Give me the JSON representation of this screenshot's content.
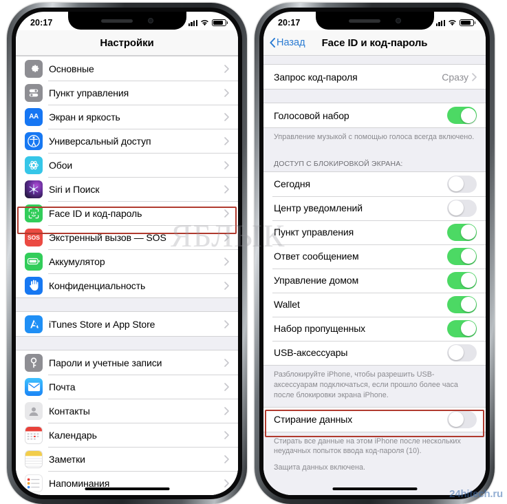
{
  "watermarks": {
    "center": "ЯБЛЫК",
    "corner": "24hitech.ru"
  },
  "status_bar": {
    "time": "20:17",
    "signal_icon": "cellular-bars-icon",
    "wifi_icon": "wifi-icon",
    "battery_icon": "battery-icon"
  },
  "left_phone": {
    "nav": {
      "title": "Настройки"
    },
    "groups": [
      {
        "rows": [
          {
            "label": "Основные",
            "icon": "gear-icon",
            "accessory": "chevron"
          },
          {
            "label": "Пункт управления",
            "icon": "control-center-icon",
            "accessory": "chevron"
          },
          {
            "label": "Экран и яркость",
            "icon": "display-icon",
            "accessory": "chevron"
          },
          {
            "label": "Универсальный доступ",
            "icon": "accessibility-icon",
            "accessory": "chevron"
          },
          {
            "label": "Обои",
            "icon": "wallpaper-icon",
            "accessory": "chevron"
          },
          {
            "label": "Siri и Поиск",
            "icon": "siri-icon",
            "accessory": "chevron"
          },
          {
            "label": "Face ID и код-пароль",
            "icon": "faceid-icon",
            "accessory": "chevron",
            "highlighted": true
          },
          {
            "label": "Экстренный вызов — SOS",
            "icon": "sos-icon",
            "accessory": "chevron"
          },
          {
            "label": "Аккумулятор",
            "icon": "battery-settings-icon",
            "accessory": "chevron"
          },
          {
            "label": "Конфиденциальность",
            "icon": "privacy-hand-icon",
            "accessory": "chevron"
          }
        ]
      },
      {
        "rows": [
          {
            "label": "iTunes Store и App Store",
            "icon": "appstore-icon",
            "accessory": "chevron"
          }
        ]
      },
      {
        "rows": [
          {
            "label": "Пароли и учетные записи",
            "icon": "key-icon",
            "accessory": "chevron"
          },
          {
            "label": "Почта",
            "icon": "mail-icon",
            "accessory": "chevron"
          },
          {
            "label": "Контакты",
            "icon": "contacts-icon",
            "accessory": "chevron"
          },
          {
            "label": "Календарь",
            "icon": "calendar-icon",
            "accessory": "chevron"
          },
          {
            "label": "Заметки",
            "icon": "notes-icon",
            "accessory": "chevron"
          },
          {
            "label": "Напоминания",
            "icon": "reminders-icon",
            "accessory": "chevron"
          }
        ]
      }
    ]
  },
  "right_phone": {
    "nav": {
      "back_label": "Назад",
      "title": "Face ID и код-пароль"
    },
    "passcode_request": {
      "label": "Запрос код-пароля",
      "value": "Сразу"
    },
    "voice_dial": {
      "label": "Голосовой набор",
      "on": true
    },
    "voice_dial_footer": "Управление музыкой с помощью голоса всегда включено.",
    "lockscreen_section_header": "ДОСТУП С БЛОКИРОВКОЙ ЭКРАНА:",
    "lockscreen_rows": [
      {
        "label": "Сегодня",
        "on": false
      },
      {
        "label": "Центр уведомлений",
        "on": false
      },
      {
        "label": "Пункт управления",
        "on": true
      },
      {
        "label": "Ответ сообщением",
        "on": true
      },
      {
        "label": "Управление домом",
        "on": true
      },
      {
        "label": "Wallet",
        "on": true
      },
      {
        "label": "Набор пропущенных",
        "on": true
      },
      {
        "label": "USB-аксессуары",
        "on": false
      }
    ],
    "usb_footer": "Разблокируйте iPhone, чтобы разрешить USB-аксессуарам подключаться, если прошло более часа после блокировки экрана iPhone.",
    "erase_data": {
      "label": "Стирание данных",
      "on": false,
      "highlighted": true
    },
    "erase_footer_1": "Стирать все данные на этом iPhone после нескольких неудачных попыток ввода код-пароля (10).",
    "erase_footer_2": "Защита данных включена."
  },
  "colors": {
    "toggle_on": "#4cd964",
    "toggle_off": "#e5e5ea",
    "highlight_border": "#b03a2e",
    "link_blue": "#2b7cd3",
    "group_bg": "#efeff4"
  }
}
